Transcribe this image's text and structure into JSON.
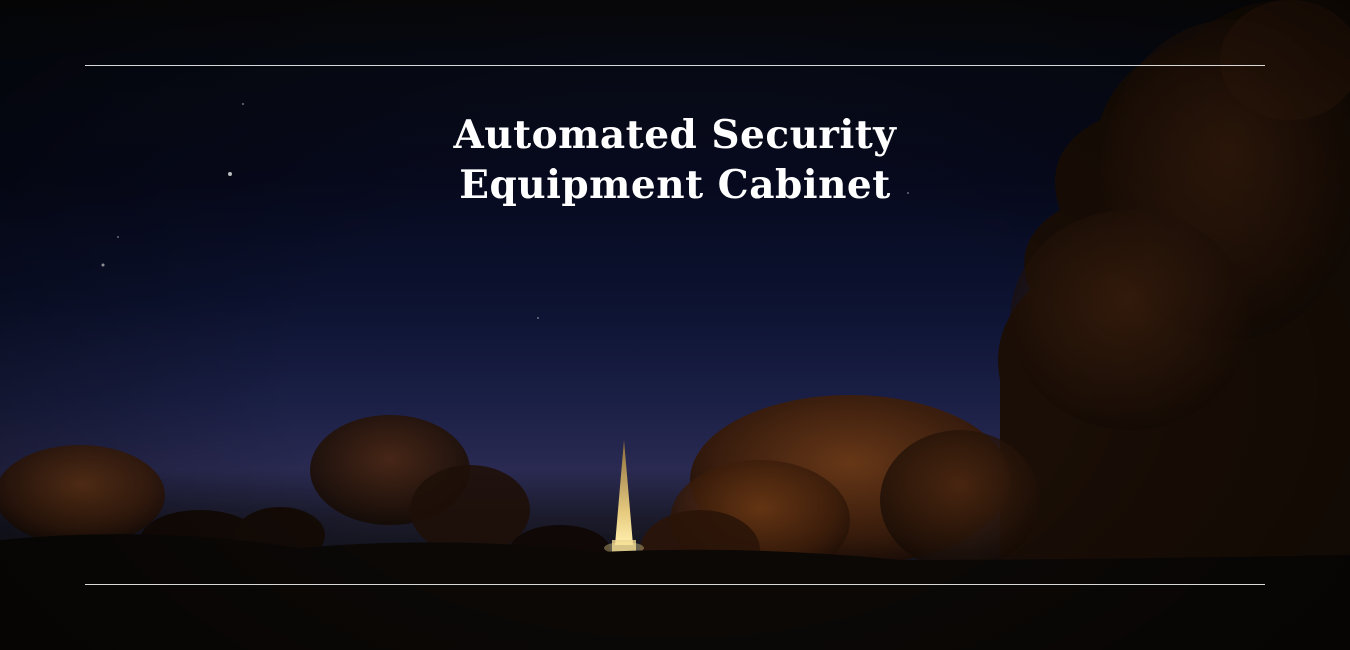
{
  "hero": {
    "title_line1": "Automated Security",
    "title_line2": "Equipment Cabinet"
  },
  "colors": {
    "sky_top": "#070a1e",
    "sky_horizon": "#2a2a52",
    "foliage": "#5a2e12",
    "spire_light": "#f0d890",
    "title_text": "#ffffff",
    "rule": "#d8d8d8"
  }
}
